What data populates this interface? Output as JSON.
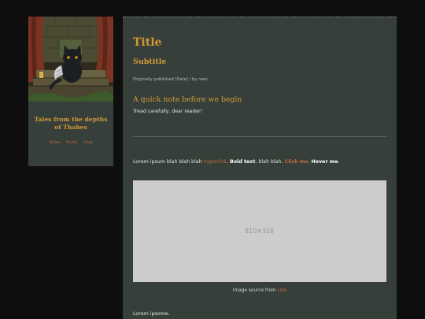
{
  "sidebar": {
    "site_title": "Tales from the depths of Thabes",
    "nav": [
      "Home",
      "Works",
      "Shop"
    ]
  },
  "main": {
    "title": "Title",
    "subtitle": "Subtitle",
    "published": "Originally published [Date] / by raen",
    "note_heading": "A quick note before we begin",
    "note_text": "Tread carefully, dear reader!",
    "paragraph": {
      "intro": "Lorem ipsum blah blah blah ",
      "hyperlink": "hyperlink",
      "sep1": ". ",
      "bold": "Bold text",
      "mid": ", blah blah. ",
      "click_me": "Click me",
      "sep2": ". ",
      "hover_me": "Hover me",
      "end": "."
    },
    "image_placeholder": "810×326",
    "caption_prefix": "Image source from ",
    "caption_link": "Link",
    "paragraph2": "Lorem ipsome."
  },
  "colors": {
    "background": "#0e0e0e",
    "panel": "#363f3a",
    "accent": "#d39a38",
    "link": "#c0683d",
    "placeholder": "#cccccc"
  }
}
